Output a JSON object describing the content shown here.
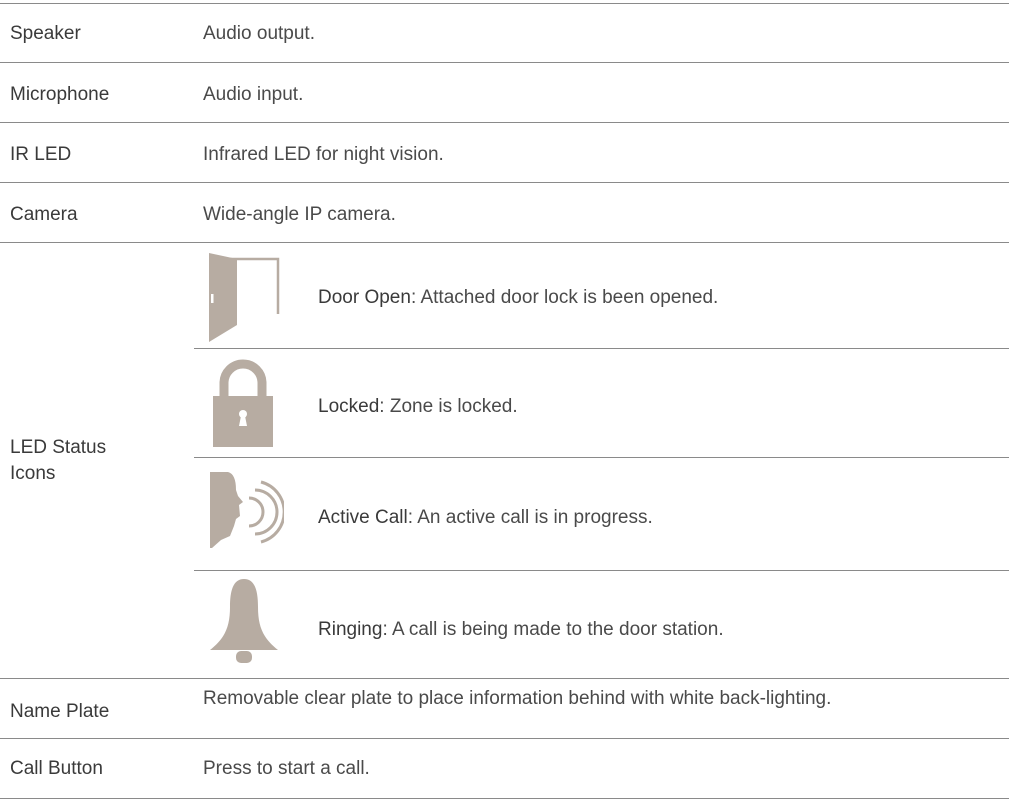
{
  "colors": {
    "rule": "#8a8a8a",
    "icon_fill": "#b7aca2",
    "text": "#3a3a3a"
  },
  "rows": [
    {
      "term": "Speaker",
      "desc": "Audio output."
    },
    {
      "term": "Microphone",
      "desc": "Audio input."
    },
    {
      "term": "IR LED",
      "desc": "Infrared LED for night vision."
    },
    {
      "term": "Camera",
      "desc": "Wide-angle IP camera."
    }
  ],
  "led": {
    "term_line1": "LED Status",
    "term_line2": "Icons",
    "items": [
      {
        "icon": "door-open-icon",
        "name": "Door Open",
        "text": ": Attached door lock is been opened."
      },
      {
        "icon": "padlock-icon",
        "name": "Locked",
        "text": ": Zone is locked."
      },
      {
        "icon": "active-call-icon",
        "name": "Active Call",
        "text": ": An active call is in progress."
      },
      {
        "icon": "bell-icon",
        "name": "Ringing",
        "text": ": A call is being made to the door station."
      }
    ]
  },
  "name_plate": {
    "term": "Name Plate",
    "desc": "Removable clear plate to place information behind with white back-lighting."
  },
  "call_button": {
    "term": "Call Button",
    "desc": "Press to start a call."
  }
}
